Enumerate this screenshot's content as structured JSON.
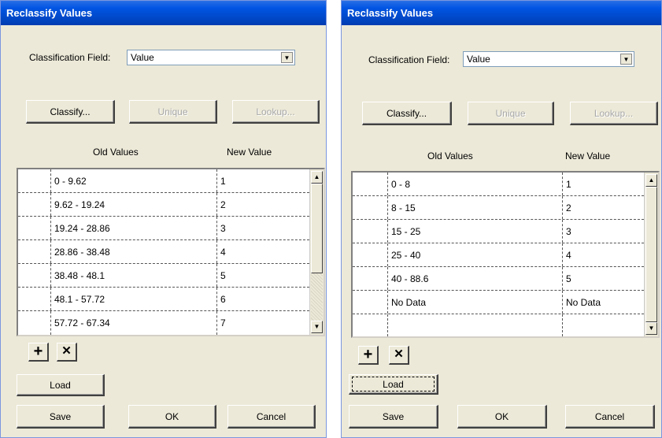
{
  "dialogs": [
    {
      "title": "Reclassify Values",
      "classification_label": "Classification Field:",
      "classification_value": "Value",
      "buttons": {
        "classify": "Classify...",
        "unique": "Unique",
        "lookup": "Lookup...",
        "load": "Load",
        "save": "Save",
        "ok": "OK",
        "cancel": "Cancel"
      },
      "headers": {
        "old": "Old Values",
        "new": "New Value"
      },
      "rows": [
        {
          "old": "0 - 9.62",
          "new": "1"
        },
        {
          "old": "9.62 - 19.24",
          "new": "2"
        },
        {
          "old": "19.24 - 28.86",
          "new": "3"
        },
        {
          "old": "28.86 - 38.48",
          "new": "4"
        },
        {
          "old": "38.48 - 48.1",
          "new": "5"
        },
        {
          "old": "48.1 - 57.72",
          "new": "6"
        },
        {
          "old": "57.72 - 67.34",
          "new": "7"
        }
      ]
    },
    {
      "title": "Reclassify Values",
      "classification_label": "Classification Field:",
      "classification_value": "Value",
      "buttons": {
        "classify": "Classify...",
        "unique": "Unique",
        "lookup": "Lookup...",
        "load": "Load",
        "save": "Save",
        "ok": "OK",
        "cancel": "Cancel"
      },
      "headers": {
        "old": "Old Values",
        "new": "New Value"
      },
      "rows": [
        {
          "old": "0 - 8",
          "new": "1"
        },
        {
          "old": "8 - 15",
          "new": "2"
        },
        {
          "old": "15 - 25",
          "new": "3"
        },
        {
          "old": "25 - 40",
          "new": "4"
        },
        {
          "old": "40 - 88.6",
          "new": "5"
        },
        {
          "old": "No Data",
          "new": "No Data"
        },
        {
          "old": "",
          "new": ""
        }
      ]
    }
  ],
  "icons": {
    "add": "+",
    "delete": "✕",
    "up": "▲",
    "down": "▼"
  }
}
